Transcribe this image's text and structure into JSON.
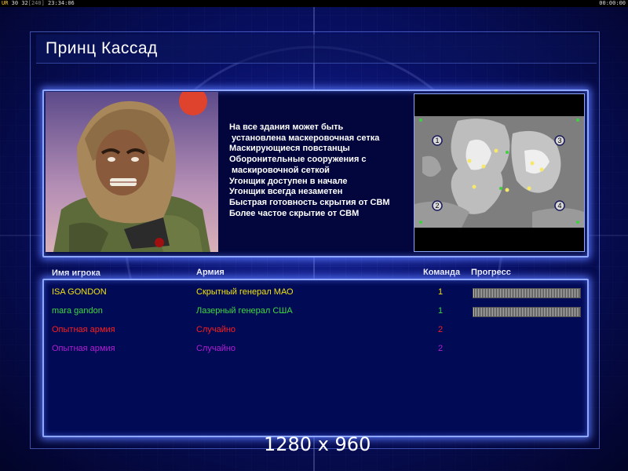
{
  "topbar": {
    "left": [
      "UR",
      "30",
      "32",
      "[240]",
      "23:34:06"
    ],
    "right": "00:00:00"
  },
  "title": "Принц Кассад",
  "description": [
    "На все здания может быть",
    " установлена маскеровочная сетка",
    "Маскирующиеся повстанцы",
    "Оборонительные сооружения с",
    " маскировочной сеткой",
    "Угонщик доступен в начале",
    "Угонщик всегда незаметен",
    "Быстрая готовность скрытия от СВМ",
    "Более частое скрытие от СВМ"
  ],
  "minimap": {
    "start_positions": [
      "1",
      "2",
      "3",
      "4"
    ]
  },
  "players_table": {
    "headers": {
      "name": "Имя игрока",
      "army": "Армия",
      "team": "Команда",
      "progress": "Прогресс"
    },
    "rows": [
      {
        "name": "ISA GONDON",
        "army": "Скрытный генерал МАО",
        "team": "1",
        "color": "#f2e20b",
        "progress": 1.0
      },
      {
        "name": "mara gandon",
        "army": "Лазерный генерал США",
        "team": "1",
        "color": "#3fd93f",
        "progress": 1.0
      },
      {
        "name": "Опытная армия",
        "army": "Случайно",
        "team": "2",
        "color": "#ff1e1e"
      },
      {
        "name": "Опытная армия",
        "army": "Случайно",
        "team": "2",
        "color": "#b41ed2"
      }
    ]
  },
  "watermark": "1280 x 960"
}
